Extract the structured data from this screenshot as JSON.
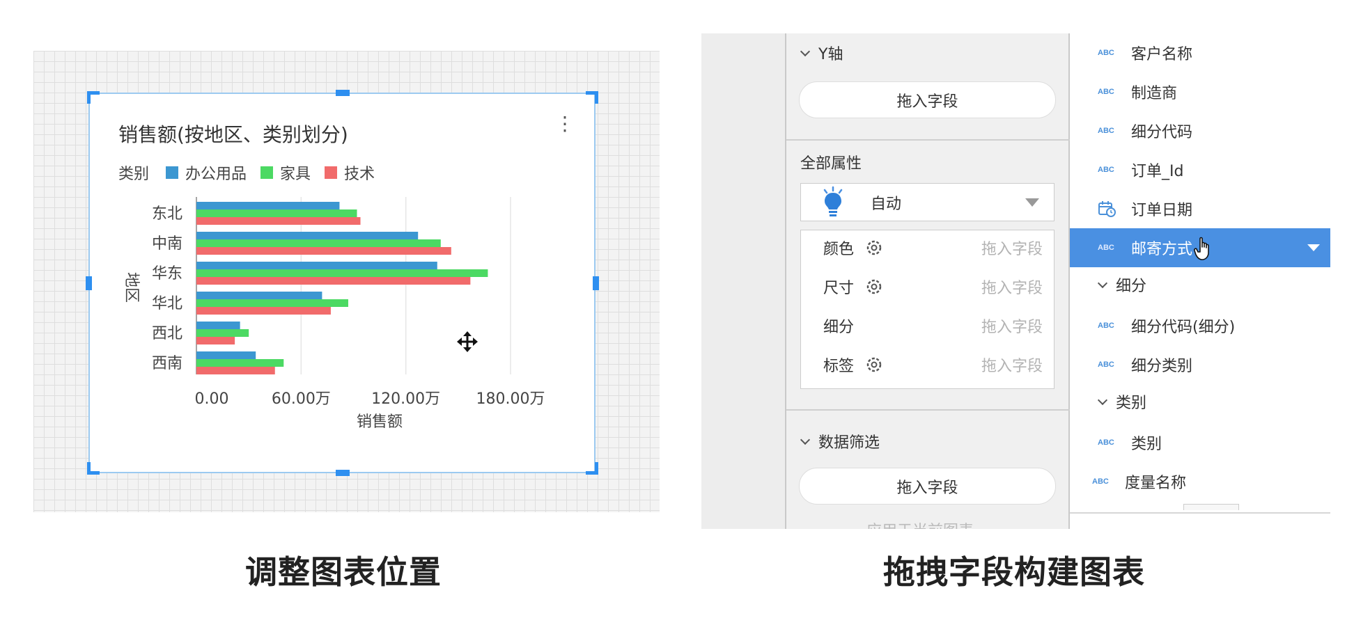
{
  "left": {
    "caption": "调整图表位置",
    "chart_title": "销售额(按地区、类别划分)",
    "legend_label": "类别",
    "legend_items": [
      {
        "name": "办公用品",
        "color": "#3c97d1"
      },
      {
        "name": "家具",
        "color": "#4cd963"
      },
      {
        "name": "技术",
        "color": "#f16b6b"
      }
    ]
  },
  "chart_data": {
    "type": "bar",
    "orientation": "horizontal",
    "title": "销售额(按地区、类别划分)",
    "xlabel": "销售额",
    "ylabel": "地区",
    "categories": [
      "东北",
      "中南",
      "华东",
      "华北",
      "西北",
      "西南"
    ],
    "series": [
      {
        "name": "办公用品",
        "color": "#3c97d1",
        "values": [
          82,
          127,
          138,
          72,
          25,
          34
        ]
      },
      {
        "name": "家具",
        "color": "#4cd963",
        "values": [
          92,
          140,
          167,
          87,
          30,
          50
        ]
      },
      {
        "name": "技术",
        "color": "#f16b6b",
        "values": [
          94,
          146,
          157,
          77,
          22,
          45
        ]
      }
    ],
    "xlim": [
      0,
      200
    ],
    "x_ticks": [
      0,
      60,
      120,
      180
    ],
    "x_tick_labels": [
      "0.00",
      "60.00万",
      "120.00万",
      "180.00万"
    ],
    "unit": "万",
    "grid": true,
    "legend_position": "top-left"
  },
  "right": {
    "caption": "拖拽字段构建图表",
    "y_axis_label": "Y轴",
    "drop_placeholder": "拖入字段",
    "all_props_label": "全部属性",
    "auto_label": "自动",
    "props": [
      {
        "label": "颜色",
        "gear": true,
        "placeholder": "拖入字段"
      },
      {
        "label": "尺寸",
        "gear": true,
        "placeholder": "拖入字段"
      },
      {
        "label": "细分",
        "gear": false,
        "placeholder": "拖入字段"
      },
      {
        "label": "标签",
        "gear": true,
        "placeholder": "拖入字段"
      }
    ],
    "filter_label": "数据筛选",
    "filter_drop": "拖入字段",
    "apply_text": "应用于当前图表",
    "abc_text": "ABC",
    "fields": [
      "客户名称",
      "制造商",
      "细分代码",
      "订单_Id",
      "订单日期",
      "邮寄方式"
    ],
    "group_seg": "细分",
    "seg_fields": [
      "细分代码(细分)",
      "细分类别"
    ],
    "group_cat": "类别",
    "cat_fields": [
      "类别"
    ],
    "measure_names": "度量名称"
  }
}
